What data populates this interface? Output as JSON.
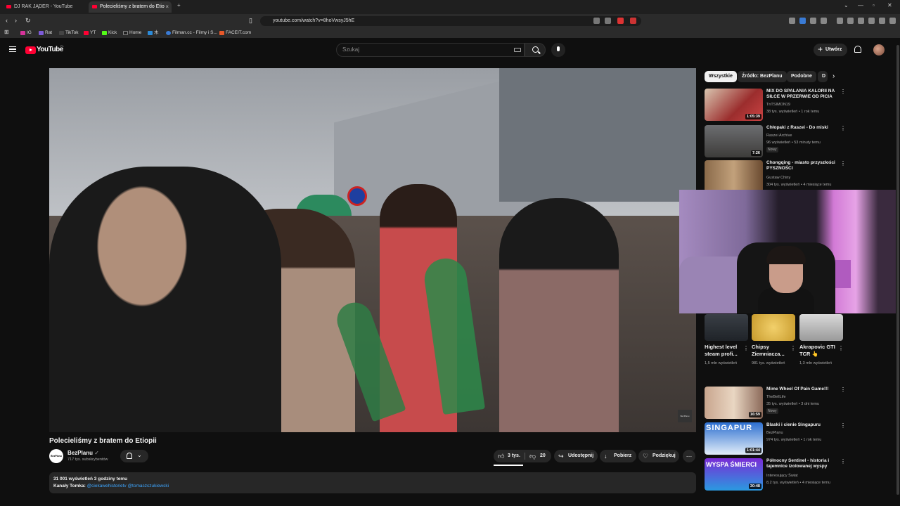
{
  "browser": {
    "tabs": [
      {
        "label": "DJ RAK JĄDER - YouTube"
      },
      {
        "label": "Polecieliśmy z bratem do Etio"
      }
    ],
    "url": "youtube.com/watch?v=8hoVwsyJ5hE",
    "bookmarks": [
      "IG",
      "Rat",
      "TikTok",
      "YT",
      "Kick",
      "Home",
      "木",
      "Filman.cc - Filmy i S...",
      "FACEIT.com"
    ]
  },
  "header": {
    "logo_text": "YouTube",
    "country_code": "PL",
    "search_placeholder": "Szukaj",
    "create_label": "Utwórz"
  },
  "video": {
    "watermark": "BezPlanu",
    "title": "Polecieliśmy z bratem do Etiopii",
    "channel": "BezPlanu",
    "channel_avatar_text": "BezPlanu",
    "subscribers": "717 tys. subskrybentów",
    "likes": "3 tys.",
    "dislikes": "20",
    "share_label": "Udostępnij",
    "download_label": "Pobierz",
    "thanks_label": "Podziękuj",
    "views_line": "31 001 wyświetleń  3 godziny temu",
    "desc_prefix": "Kanały Tomka: ",
    "desc_links": "@ciekawehistorietv @tomaszczukiewski"
  },
  "chips": [
    "Wszystkie",
    "Źródło: BezPlanu",
    "Podobne",
    "D"
  ],
  "recommendations_top": [
    {
      "title": "MIX DO SPALANIA KALORII NA SIŁCE W PRZERWIE OD PICIA ...",
      "channel": "TnTSIMON19",
      "meta": "38 tys. wyświetleń • 1 rok temu",
      "duration": "1:05:39",
      "badge": ""
    },
    {
      "title": "Chłopaki z Raszei - Do miski",
      "channel": "Raszei Archive",
      "meta": "96 wyświetleń • 53 minuty temu",
      "duration": "7:26",
      "badge": "Nowy"
    },
    {
      "title": "Chongqing - miasto przyszłości PYSZNOŚCI",
      "channel": "Gustaw Chiny",
      "meta": "304 tys. wyświetleń • 4 miesiące temu",
      "duration": "",
      "badge": ""
    }
  ],
  "shorts": [
    {
      "title": "Highest level steam profi...",
      "views": "1,5 mln wyświetleń"
    },
    {
      "title": "Chipsy Ziemniacza...",
      "views": "981 tys. wyświetleń"
    },
    {
      "title": "Akrapovic GTI TCR 👆",
      "views": "1,3 mln wyświetleń"
    }
  ],
  "recommendations_bottom": [
    {
      "title": "Mime Wheel Of Pain Game!!!",
      "channel": "TheBellLife",
      "meta": "35 tys. wyświetleń • 3 dni temu",
      "duration": "16:59",
      "badge": "Nowy"
    },
    {
      "title": "Blaski i cienie Singapuru",
      "channel": "BezPlanu",
      "meta": "974 tys. wyświetleń • 1 rok temu",
      "duration": "1:01:44",
      "badge": "",
      "thumb_text": "SINGAPUR"
    },
    {
      "title": "Północny Sentinel - historia i tajemnice izolowanej wyspy",
      "channel": "Interesujący Świat",
      "meta": "8,2 tys. wyświetleń • 4 miesiące temu",
      "duration": "30:48",
      "badge": "",
      "thumb_text": "WYSPA ŚMIERCI"
    }
  ],
  "colors": {
    "brand_red": "#ff0033",
    "background": "#0f0f0f",
    "link": "#3ea6ff"
  }
}
